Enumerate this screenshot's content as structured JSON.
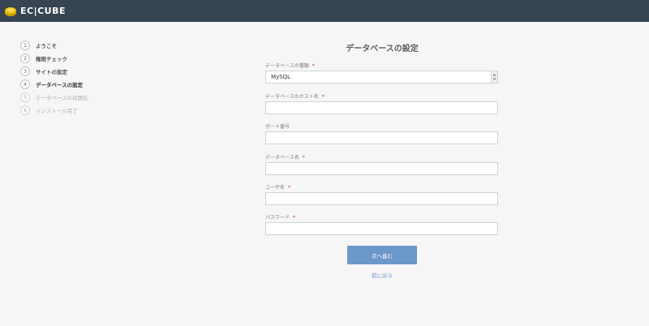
{
  "app": {
    "logo_text": "EC|CUBE"
  },
  "steps": [
    {
      "num": "1",
      "label": "ようこそ",
      "state": "done"
    },
    {
      "num": "2",
      "label": "権限チェック",
      "state": "done"
    },
    {
      "num": "3",
      "label": "サイトの設定",
      "state": "done"
    },
    {
      "num": "4",
      "label": "データベースの設定",
      "state": "current"
    },
    {
      "num": "5",
      "label": "データベースの初期化",
      "state": "todo"
    },
    {
      "num": "6",
      "label": "インストール完了",
      "state": "todo"
    }
  ],
  "page": {
    "title": "データベースの設定"
  },
  "form": {
    "db_type": {
      "label": "データベースの種類",
      "required": "*",
      "value": "MySQL"
    },
    "db_host": {
      "label": "データベースのホスト名",
      "required": "*",
      "value": ""
    },
    "db_port": {
      "label": "ポート番号",
      "value": ""
    },
    "db_name": {
      "label": "データベース名",
      "required": "*",
      "value": ""
    },
    "db_user": {
      "label": "ユーザ名",
      "required": "*",
      "value": ""
    },
    "db_pass": {
      "label": "パスワード",
      "required": "*",
      "value": ""
    }
  },
  "actions": {
    "next_label": "次へ進む",
    "back_label": "前に戻る"
  },
  "colors": {
    "topbar": "#374452",
    "primary": "#6c97c9",
    "background": "#f6f6f6"
  }
}
